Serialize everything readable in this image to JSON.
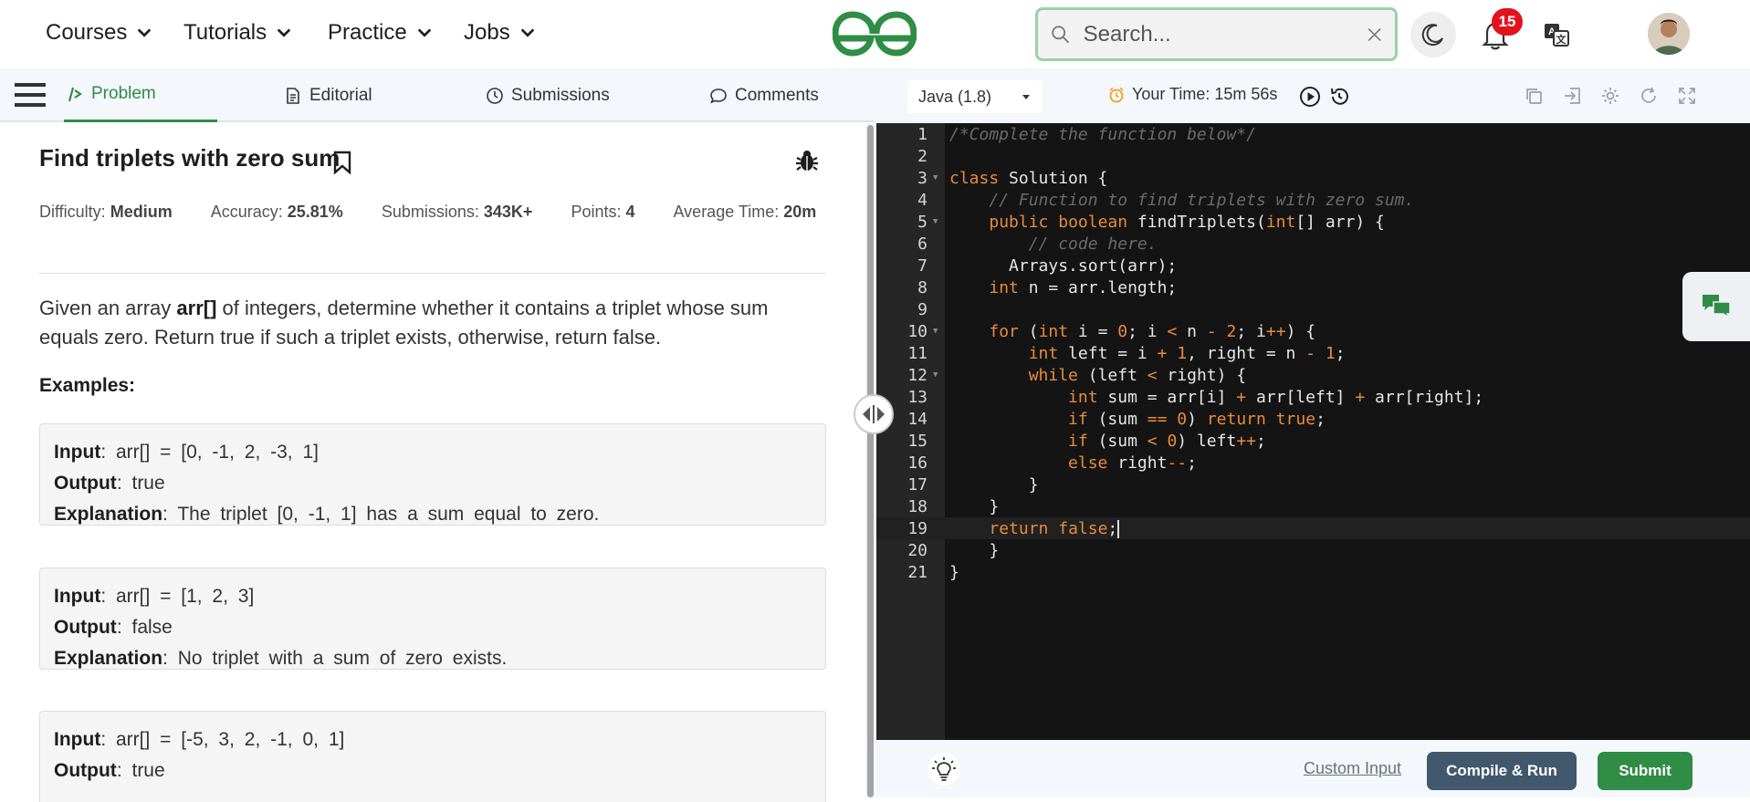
{
  "nav": {
    "items": [
      {
        "label": "Courses"
      },
      {
        "label": "Tutorials"
      },
      {
        "label": "Practice"
      },
      {
        "label": "Jobs"
      }
    ],
    "search_placeholder": "Search...",
    "notification_count": "15",
    "brand_color": "#2f8d46"
  },
  "tabs": [
    {
      "label": "Problem",
      "icon": "code-slash-icon",
      "active": true
    },
    {
      "label": "Editorial",
      "icon": "document-icon"
    },
    {
      "label": "Submissions",
      "icon": "clock-icon"
    },
    {
      "label": "Comments",
      "icon": "chat-bubble-icon"
    }
  ],
  "problem": {
    "title": "Find triplets with zero sum",
    "meta": [
      {
        "label": "Difficulty:",
        "value": "Medium"
      },
      {
        "label": "Accuracy:",
        "value": "25.81%"
      },
      {
        "label": "Submissions:",
        "value": "343K+"
      },
      {
        "label": "Points:",
        "value": "4"
      },
      {
        "label": "Average Time:",
        "value": "20m"
      }
    ],
    "desc_before": "Given an array ",
    "desc_bold": "arr[]",
    "desc_after": " of integers, determine whether it contains a triplet whose sum equals zero. Return true if such a triplet exists, otherwise, return false.",
    "examples_label": "Examples:",
    "examples": [
      {
        "input": "arr[] = [0, -1, 2, -3, 1]",
        "output": "true",
        "explanation": "The triplet [0, -1, 1] has a sum equal to zero."
      },
      {
        "input": "arr[] = [1, 2, 3]",
        "output": "false",
        "explanation": "No triplet with a sum of zero exists."
      },
      {
        "input": "arr[] = [-5, 3, 2, -1, 0, 1]",
        "output": "true",
        "explanation": ""
      }
    ],
    "labels": {
      "input": "Input",
      "output": "Output",
      "explanation": "Explanation"
    }
  },
  "editor": {
    "language": "Java (1.8)",
    "timer_label": "Your Time: 15m 56s",
    "line_numbers": [
      "1",
      "2",
      "3",
      "4",
      "5",
      "6",
      "7",
      "8",
      "9",
      "10",
      "11",
      "12",
      "13",
      "14",
      "15",
      "16",
      "17",
      "18",
      "19",
      "20",
      "21"
    ]
  },
  "footer": {
    "custom_input": "Custom Input",
    "compile": "Compile & Run",
    "submit": "Submit"
  }
}
